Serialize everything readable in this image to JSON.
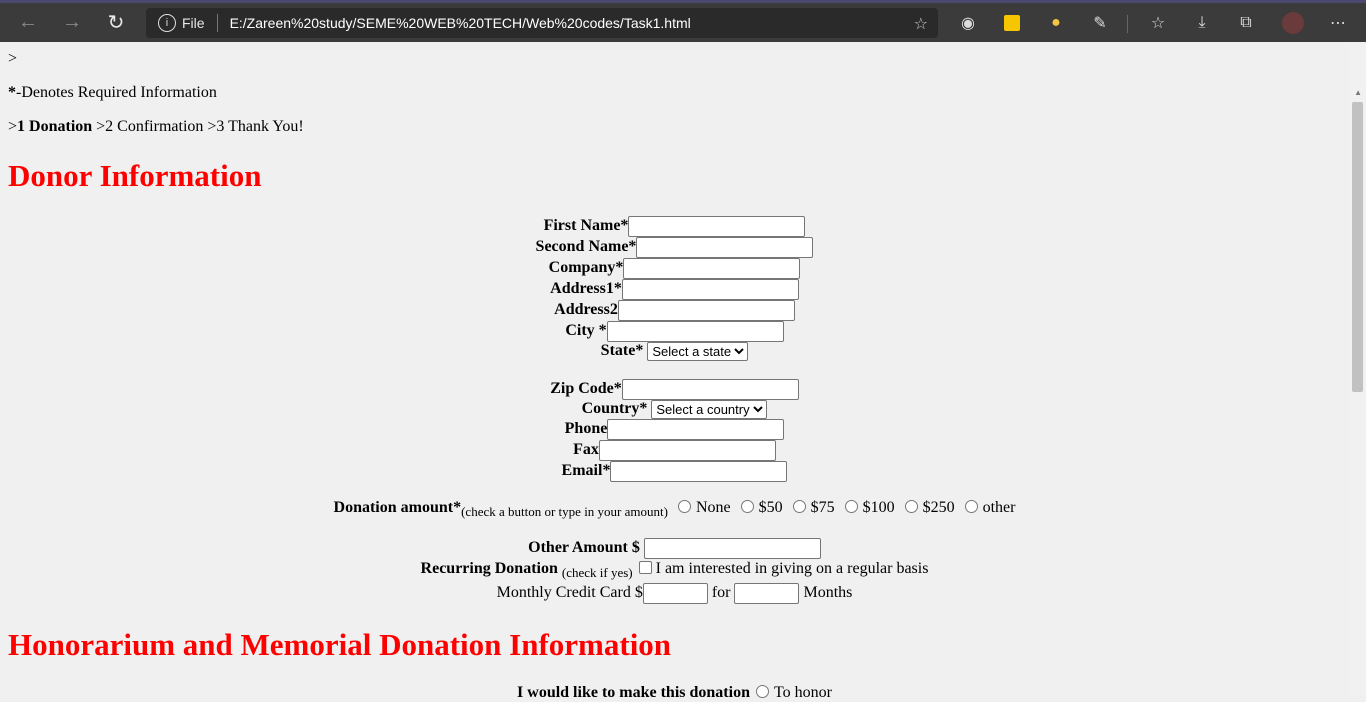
{
  "browser": {
    "file_label": "File",
    "url": "E:/Zareen%20study/SEME%20WEB%20TECH/Web%20codes/Task1.html"
  },
  "page": {
    "stray": ">",
    "required_star": "*",
    "required_note": "-Denotes Required Information",
    "steps": {
      "prefix1": ">",
      "step1": "1 Donation",
      "step2": " >2 Confirmation >3 Thank You!"
    },
    "donor_heading": "Donor Information",
    "fields": {
      "first_name": "First Name*",
      "second_name": "Second Name*",
      "company": "Company*",
      "address1": "Address1*",
      "address2": "Address2",
      "city": "City *",
      "state": "State*",
      "zip": "Zip Code*",
      "country": "Country*",
      "phone": "Phone",
      "fax": "Fax",
      "email": "Email*"
    },
    "selects": {
      "state_selected": "Select a state",
      "country_selected": "Select a country"
    },
    "donation": {
      "label": "Donation amount*",
      "hint": "(check a button or type in your amount)",
      "options": [
        "None",
        "$50",
        "$75",
        "$100",
        "$250",
        "other"
      ]
    },
    "other_amount_label": "Other Amount $",
    "recurring": {
      "label": "Recurring Donation",
      "hint": "(check if yes)",
      "checkbox_text": "I am interested in giving on a regular basis"
    },
    "monthly": {
      "prefix": "Monthly Credit Card $",
      "for": "for",
      "months": "Months"
    },
    "honor_heading": "Honorarium and Memorial Donation Information",
    "honor_line": {
      "label": "I would like to make this donation",
      "option": "To honor"
    }
  }
}
